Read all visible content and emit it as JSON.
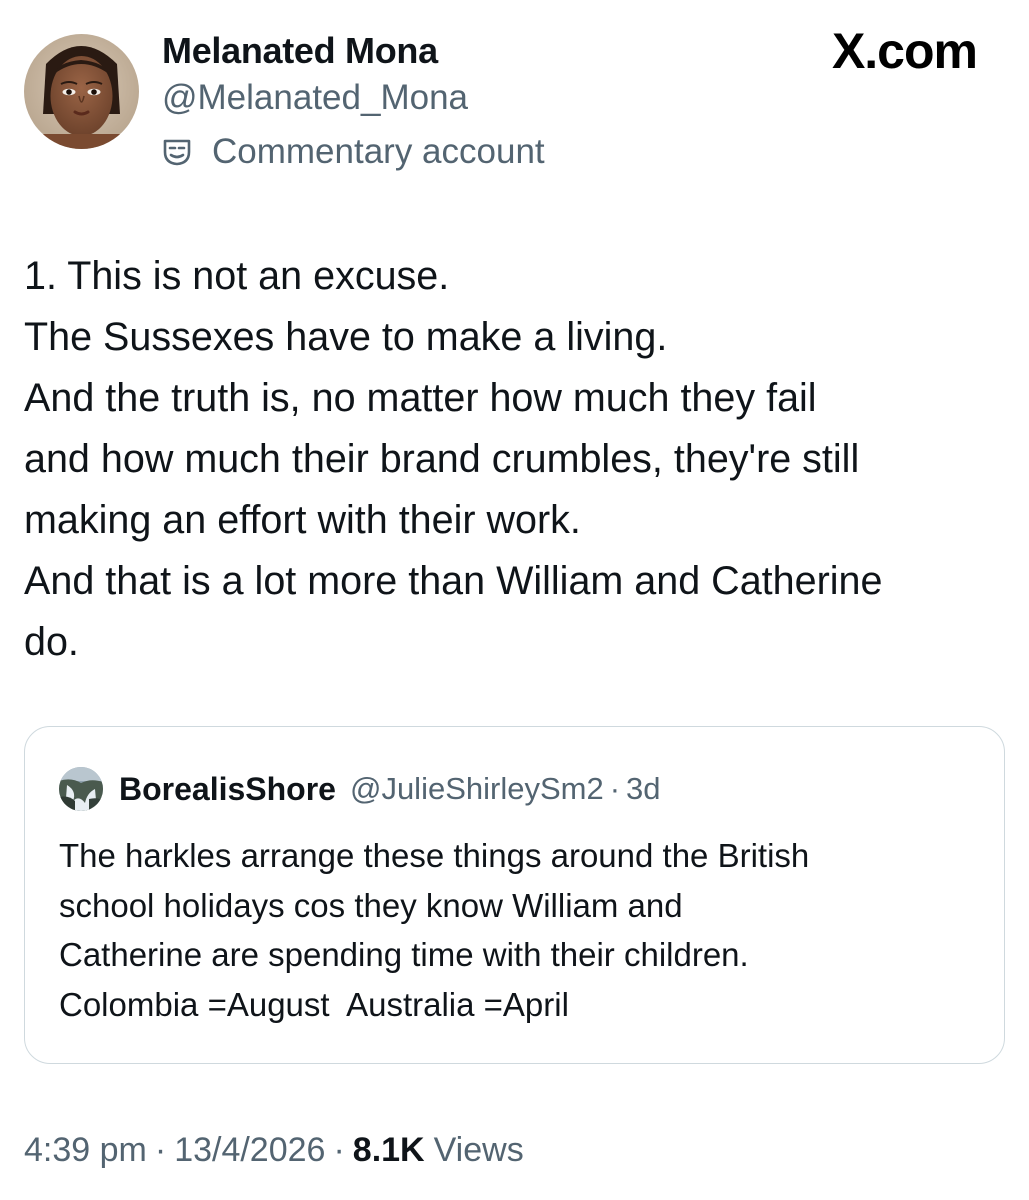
{
  "author": {
    "display_name": "Melanated Mona",
    "handle": "@Melanated_Mona",
    "label": "Commentary account",
    "label_icon": "theater-mask-icon",
    "avatar": "profile-photo"
  },
  "brand": {
    "text": "X.com"
  },
  "tweet": {
    "lines": [
      "1. This is not an excuse.",
      "The Sussexes have to make a living.",
      "And the truth is, no matter how much they fail",
      "and how much their brand crumbles, they're still",
      "making an effort with their work.",
      "And that is a lot more than William and Catherine",
      "do."
    ]
  },
  "quoted_tweet": {
    "display_name": "BorealisShore",
    "handle": "@JulieShirleySm2",
    "separator": "·",
    "age": "3d",
    "avatar": "waterfall-photo",
    "lines": [
      "The harkles arrange these things around the British",
      "school holidays cos they know William and",
      "Catherine are spending time with their children.",
      "Colombia =August  Australia =April"
    ]
  },
  "meta": {
    "time": "4:39 pm",
    "date": "13/4/2026",
    "separator": "·",
    "views_count": "8.1K",
    "views_label": "Views"
  },
  "colors": {
    "text_primary": "#0f1419",
    "text_secondary": "#536471",
    "border": "#cfd9de",
    "background": "#ffffff"
  }
}
